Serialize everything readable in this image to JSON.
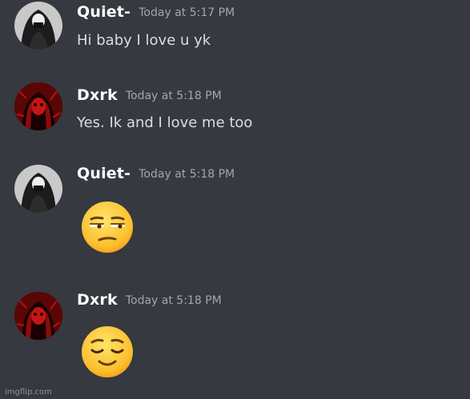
{
  "messages": [
    {
      "username": "Quiet-",
      "timestamp": "Today at 5:17 PM",
      "text": "Hi baby I love u yk",
      "avatar": "user-avatar-gray"
    },
    {
      "username": "Dxrk",
      "timestamp": "Today at 5:18 PM",
      "text": "Yes. Ik and I love me too",
      "avatar": "user-avatar-red"
    },
    {
      "username": "Quiet-",
      "timestamp": "Today at 5:18 PM",
      "emoji": "unamused-face-emoji",
      "avatar": "user-avatar-gray"
    },
    {
      "username": "Dxrk",
      "timestamp": "Today at 5:18 PM",
      "emoji": "relieved-face-emoji",
      "avatar": "user-avatar-red"
    }
  ],
  "watermark": "imgflip.com",
  "colors": {
    "background": "#36393f",
    "username": "#ffffff",
    "timestamp": "#a3a6aa",
    "message_text": "#dcddde"
  }
}
